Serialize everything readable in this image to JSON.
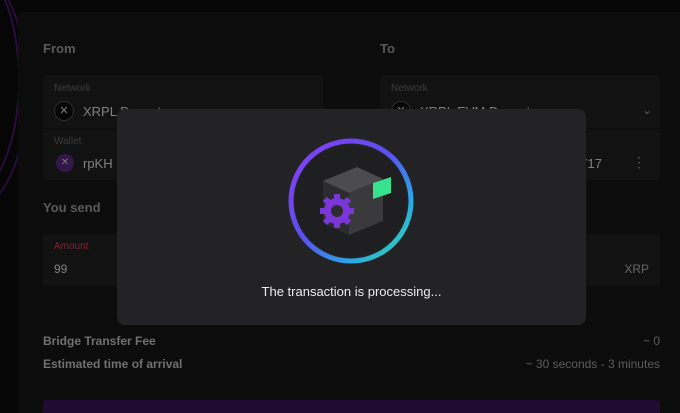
{
  "from": {
    "title": "From",
    "network": {
      "label": "Network",
      "value": "XRPL Devnet",
      "icon": "xrpl-icon"
    },
    "wallet": {
      "label": "Wallet",
      "value": "rpKH",
      "icon": "xrpl-wallet-icon"
    }
  },
  "to": {
    "title": "To",
    "network": {
      "label": "Network",
      "value": "XRPL EVM Devnet",
      "icon": "xrpl-icon"
    },
    "wallet": {
      "value": "717"
    }
  },
  "send": {
    "title": "You send",
    "amount_label": "Amount",
    "amount_value": "99",
    "currency": "XRP"
  },
  "fees": {
    "fee_label": "Bridge Transfer Fee",
    "fee_value": "~ 0",
    "eta_label": "Estimated time of arrival",
    "eta_value": "~ 30 seconds - 3 minutes"
  },
  "modal": {
    "message": "The transaction is processing...",
    "icon": "processing-gear-icon"
  },
  "colors": {
    "ring_start": "#7b3cf0",
    "ring_end": "#2ee59d",
    "amount_label": "#e0435a",
    "button": "#3a145e"
  }
}
